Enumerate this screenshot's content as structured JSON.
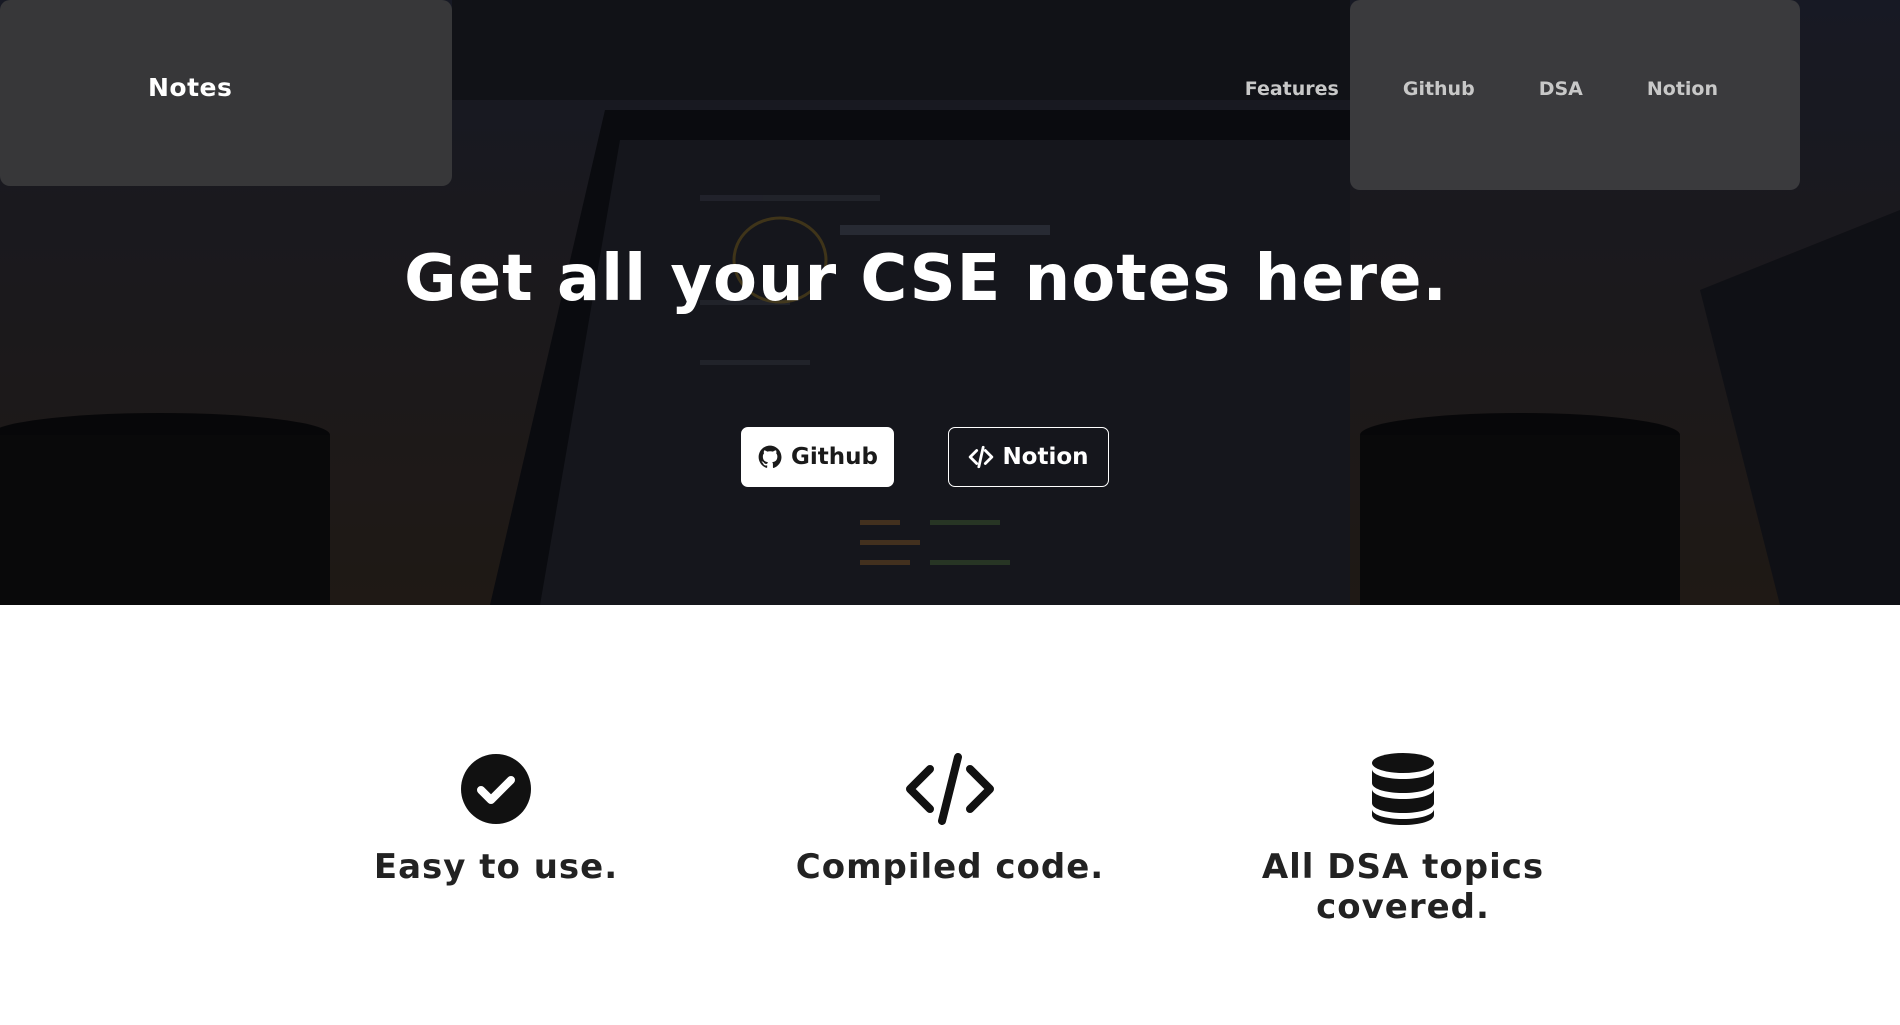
{
  "navbar": {
    "brand": "Notes",
    "links": [
      "Features",
      "Github",
      "DSA",
      "Notion"
    ]
  },
  "hero": {
    "title": "Get all your CSE notes here.",
    "buttons": {
      "github": {
        "label": "Github",
        "icon": "github-icon"
      },
      "notion": {
        "label": "Notion",
        "icon": "code-icon"
      }
    }
  },
  "features": [
    {
      "label": "Easy to use.",
      "icon": "check-circle-icon"
    },
    {
      "label": "Compiled code.",
      "icon": "code-icon"
    },
    {
      "label": "All DSA topics covered.",
      "icon": "database-icon"
    }
  ],
  "colors": {
    "hero_overlay": "#1b1d25",
    "text_light": "#ffffff",
    "nav_link": "#c8c8c8",
    "feature_text": "#222222"
  }
}
